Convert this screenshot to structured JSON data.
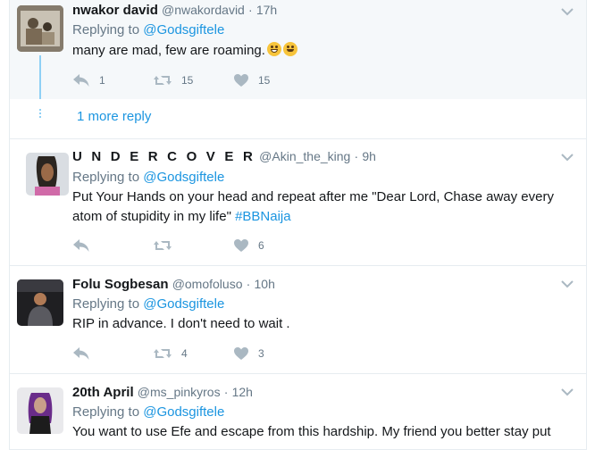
{
  "tweets": [
    {
      "fullname": "nwakor david",
      "username": "@nwakordavid",
      "sep": "·",
      "time": "17h",
      "replying_label": "Replying to",
      "mention": "@Godsgiftele",
      "text": "many are mad,  few are roaming.",
      "reply_count": "1",
      "retweet_count": "15",
      "like_count": "15"
    },
    {
      "fullname": "U N D E R C O V E R",
      "username": "@Akin_the_king",
      "sep": "·",
      "time": "9h",
      "replying_label": "Replying to",
      "mention": "@Godsgiftele",
      "text_line1": "Put Your Hands on your head and repeat after me \"Dear Lord, Chase away every",
      "text_line2": "atom of stupidity in my life\" ",
      "hashtag": "#BBNaija",
      "reply_count": "",
      "retweet_count": "",
      "like_count": "6"
    },
    {
      "fullname": "Folu Sogbesan",
      "username": "@omofoluso",
      "sep": "·",
      "time": "10h",
      "replying_label": "Replying to",
      "mention": "@Godsgiftele",
      "text": "RIP in advance.  I don't need to wait .",
      "reply_count": "",
      "retweet_count": "4",
      "like_count": "3"
    },
    {
      "fullname": "20th April",
      "username": "@ms_pinkyros",
      "sep": "·",
      "time": "12h",
      "replying_label": "Replying to",
      "mention": "@Godsgiftele",
      "text": "You want to use Efe and escape from this hardship. My friend you better stay put"
    }
  ],
  "more_reply": "1 more reply",
  "colors": {
    "link": "#1b95e0",
    "muted": "#657786",
    "icon": "#aab8c2",
    "thread": "#8fd0f5",
    "highlight_bg": "#f5f8fa"
  },
  "icons": [
    "reply-icon",
    "retweet-icon",
    "heart-icon",
    "caret-down-icon",
    "grinning-emoji-icon",
    "smiling-emoji-icon"
  ]
}
